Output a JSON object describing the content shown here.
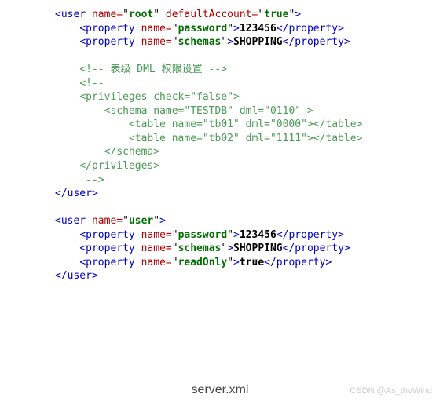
{
  "users": [
    {
      "name": "root",
      "defaultAccount": "true",
      "properties": [
        {
          "name": "password",
          "value": "123456"
        },
        {
          "name": "schemas",
          "value": "SHOPPING"
        }
      ],
      "comment": {
        "title": "表级 DML 权限设置",
        "privileges_check": "false",
        "schema": {
          "name": "TESTDB",
          "dml": "0110"
        },
        "tables": [
          {
            "name": "tb01",
            "dml": "0000"
          },
          {
            "name": "tb02",
            "dml": "1111"
          }
        ]
      }
    },
    {
      "name": "user",
      "properties": [
        {
          "name": "password",
          "value": "123456"
        },
        {
          "name": "schemas",
          "value": "SHOPPING"
        },
        {
          "name": "readOnly",
          "value": "true"
        }
      ]
    }
  ],
  "caption": "server.xml",
  "watermark": "CSDN @As_theWind"
}
